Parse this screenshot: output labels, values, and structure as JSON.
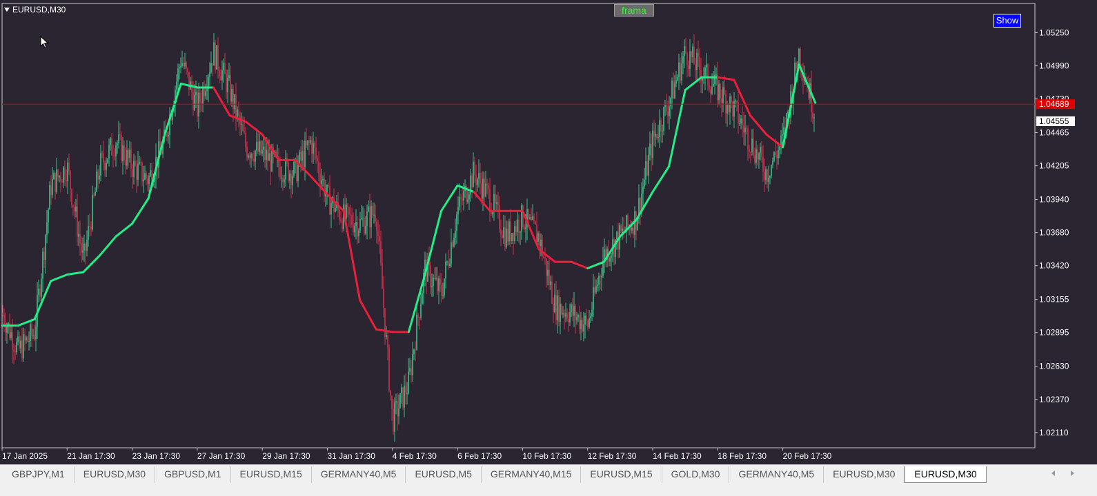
{
  "window": {
    "symbol": "EURUSD,M30",
    "indicator_label": "frama",
    "show_button": "Show",
    "colors": {
      "background": "#2a2530",
      "border": "#cccccc",
      "bull_candle": "#3cc48a",
      "bear_candle": "#d2304e",
      "ma_up": "#22ee88",
      "ma_down": "#e8203c",
      "price_line": "#c01010",
      "axis_text": "#ffffff"
    }
  },
  "chart_data": {
    "type": "line",
    "title": "",
    "xlabel": "",
    "ylabel": "",
    "ylim": [
      1.0199,
      1.0548
    ],
    "grid": false,
    "x_ticks": [
      "17 Jan 2025",
      "21 Jan 17:30",
      "23 Jan 17:30",
      "27 Jan 17:30",
      "29 Jan 17:30",
      "31 Jan 17:30",
      "4 Feb 17:30",
      "6 Feb 17:30",
      "10 Feb 17:30",
      "12 Feb 17:30",
      "14 Feb 17:30",
      "18 Feb 17:30",
      "20 Feb 17:30"
    ],
    "y_ticks": [
      "1.05250",
      "1.04990",
      "1.04730",
      "1.04465",
      "1.04205",
      "1.03940",
      "1.03680",
      "1.03420",
      "1.03155",
      "1.02895",
      "1.02630",
      "1.02370",
      "1.02110"
    ],
    "price_line": {
      "value": 1.04689,
      "label": "1.04689"
    },
    "current_price": {
      "value": 1.04555,
      "label": "1.04555"
    },
    "series": [
      {
        "name": "",
        "kind": "price",
        "x": [
          0,
          0.25,
          0.5,
          0.75,
          1,
          1.25,
          1.5,
          1.75,
          2,
          2.25,
          2.5,
          2.75,
          3,
          3.25,
          3.5,
          3.75,
          4,
          4.25,
          4.5,
          4.75,
          5,
          5.25,
          5.5,
          5.75,
          6,
          6.25,
          6.5,
          6.75,
          7,
          7.25,
          7.5,
          7.75,
          8,
          8.25,
          8.5,
          8.75,
          9,
          9.25,
          9.5,
          9.75,
          10,
          10.25,
          10.5,
          10.75,
          11,
          11.25,
          11.5,
          11.75,
          12,
          12.25,
          12.5
        ],
        "values": [
          1.0305,
          1.0275,
          1.029,
          1.0405,
          1.042,
          1.0345,
          1.042,
          1.044,
          1.042,
          1.041,
          1.044,
          1.0505,
          1.0465,
          1.051,
          1.048,
          1.0435,
          1.043,
          1.042,
          1.0415,
          1.044,
          1.0395,
          1.038,
          1.0375,
          1.0385,
          1.022,
          1.025,
          1.034,
          1.032,
          1.0385,
          1.0415,
          1.0395,
          1.0365,
          1.038,
          1.0365,
          1.031,
          1.0305,
          1.0295,
          1.035,
          1.0365,
          1.038,
          1.044,
          1.047,
          1.051,
          1.0495,
          1.048,
          1.0465,
          1.044,
          1.0415,
          1.044,
          1.051,
          1.046
        ]
      },
      {
        "name": "",
        "kind": "frama",
        "x": [
          0,
          0.25,
          0.5,
          0.75,
          1,
          1.25,
          1.5,
          1.75,
          2,
          2.25,
          2.5,
          2.75,
          3,
          3.25,
          3.5,
          3.75,
          4,
          4.25,
          4.5,
          4.75,
          5,
          5.25,
          5.5,
          5.75,
          6,
          6.25,
          6.5,
          6.75,
          7,
          7.25,
          7.5,
          7.75,
          8,
          8.25,
          8.5,
          8.75,
          9,
          9.25,
          9.5,
          9.75,
          10,
          10.25,
          10.5,
          10.75,
          11,
          11.25,
          11.5,
          11.75,
          12,
          12.25,
          12.5
        ],
        "values": [
          1.0295,
          1.0295,
          1.03,
          1.033,
          1.0335,
          1.0337,
          1.035,
          1.0365,
          1.0375,
          1.0395,
          1.0445,
          1.0485,
          1.0482,
          1.0482,
          1.046,
          1.0455,
          1.0445,
          1.0425,
          1.0425,
          1.0412,
          1.0398,
          1.0385,
          1.0315,
          1.0292,
          1.029,
          1.029,
          1.0335,
          1.0385,
          1.0405,
          1.04,
          1.0385,
          1.0385,
          1.0385,
          1.0355,
          1.0345,
          1.0345,
          1.034,
          1.0345,
          1.0365,
          1.0378,
          1.04,
          1.042,
          1.048,
          1.049,
          1.049,
          1.0488,
          1.046,
          1.0445,
          1.0435,
          1.05,
          1.047
        ],
        "direction": [
          "up",
          "up",
          "up",
          "up",
          "up",
          "up",
          "up",
          "up",
          "up",
          "up",
          "up",
          "up",
          "up",
          "down",
          "down",
          "down",
          "down",
          "down",
          "down",
          "down",
          "down",
          "down",
          "down",
          "down",
          "down",
          "up",
          "up",
          "up",
          "up",
          "down",
          "down",
          "down",
          "down",
          "down",
          "down",
          "down",
          "up",
          "up",
          "up",
          "up",
          "up",
          "up",
          "up",
          "up",
          "down",
          "down",
          "down",
          "down",
          "up",
          "up",
          "down"
        ]
      }
    ]
  },
  "tabs": [
    {
      "label": "GBPJPY,M1",
      "active": false
    },
    {
      "label": "EURUSD,M30",
      "active": false
    },
    {
      "label": "GBPUSD,M1",
      "active": false
    },
    {
      "label": "EURUSD,M15",
      "active": false
    },
    {
      "label": "GERMANY40,M5",
      "active": false
    },
    {
      "label": "EURUSD,M5",
      "active": false
    },
    {
      "label": "GERMANY40,M15",
      "active": false
    },
    {
      "label": "EURUSD,M15",
      "active": false
    },
    {
      "label": "GOLD,M30",
      "active": false
    },
    {
      "label": "GERMANY40,M5",
      "active": false
    },
    {
      "label": "EURUSD,M30",
      "active": false
    },
    {
      "label": "EURUSD,M30",
      "active": true
    }
  ]
}
